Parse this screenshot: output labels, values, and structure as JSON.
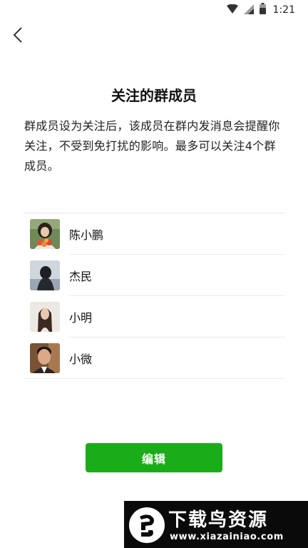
{
  "status_bar": {
    "time": "1:21",
    "icons": [
      "wifi-icon",
      "signal-icon",
      "battery-icon"
    ]
  },
  "nav": {
    "back_icon": "chevron-left-icon"
  },
  "page": {
    "title": "关注的群成员",
    "description": "群成员设为关注后，该成员在群内发消息会提醒你关注，不受到免打扰的影响。最多可以关注4个群成员。"
  },
  "members": [
    {
      "name": "陈小鹏",
      "avatar": "avatar-photo-woman-with-flowers"
    },
    {
      "name": "杰民",
      "avatar": "avatar-photo-person-back-view"
    },
    {
      "name": "小明",
      "avatar": "avatar-photo-woman-long-hair"
    },
    {
      "name": "小微",
      "avatar": "avatar-photo-smiling-man"
    }
  ],
  "actions": {
    "edit_label": "编辑"
  },
  "watermark": {
    "title": "下载鸟资源",
    "url": "www.xiazainiao.com"
  },
  "colors": {
    "accent_green": "#1aad19",
    "text_primary": "#111111",
    "divider": "#ececec"
  }
}
